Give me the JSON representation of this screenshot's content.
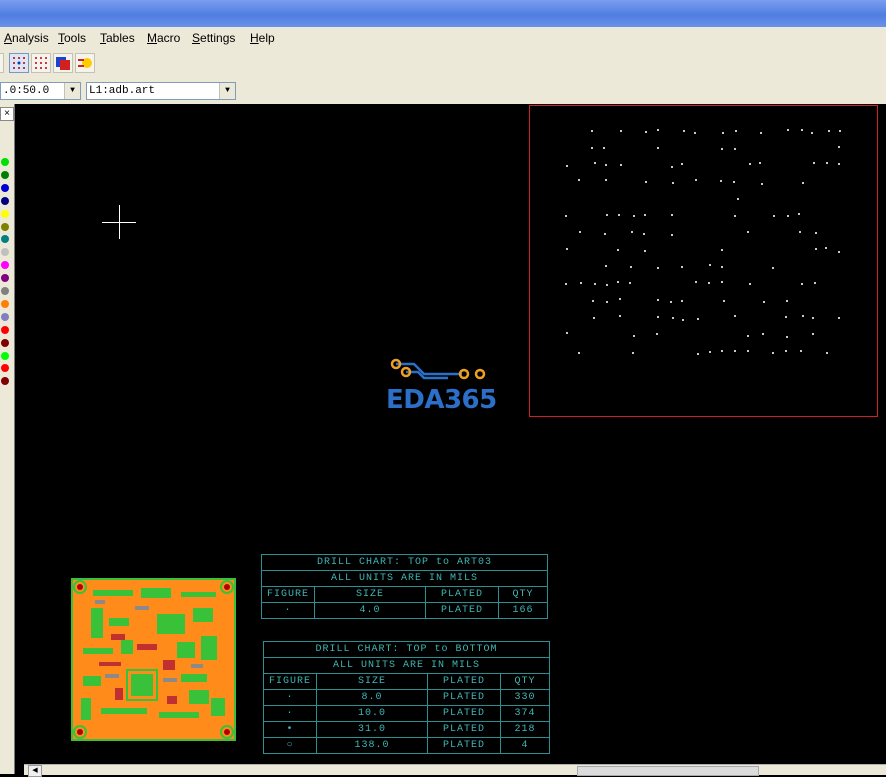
{
  "menu": [
    "Analysis",
    "Tools",
    "Tables",
    "Macro",
    "Settings",
    "Help"
  ],
  "toolbar": {
    "grid_combo_value": ".0:50.0",
    "layer_combo_value": "L1:adb.art"
  },
  "left_panel": {
    "close_glyph": "×",
    "layer_colors": [
      "#00e000",
      "#008000",
      "#0000d0",
      "#000080",
      "#ffff00",
      "#808000",
      "#008080",
      "#c0c0c0",
      "#ff00ff",
      "#800080",
      "#808080",
      "#ff8000",
      "#8080c0",
      "#ff0000",
      "#800000",
      "#00ff00",
      "#ff0000",
      "#800000"
    ]
  },
  "logo": {
    "text": "EDA365"
  },
  "drill_chart_1": {
    "title": "DRILL CHART: TOP to ART03",
    "subtitle": "ALL UNITS ARE IN MILS",
    "headers": [
      "FIGURE",
      "SIZE",
      "PLATED",
      "QTY"
    ],
    "rows": [
      {
        "figure": "·",
        "size": "4.0",
        "plated": "PLATED",
        "qty": "166"
      }
    ]
  },
  "drill_chart_2": {
    "title": "DRILL CHART: TOP to BOTTOM",
    "subtitle": "ALL UNITS ARE IN MILS",
    "headers": [
      "FIGURE",
      "SIZE",
      "PLATED",
      "QTY"
    ],
    "rows": [
      {
        "figure": "·",
        "size": "8.0",
        "plated": "PLATED",
        "qty": "330"
      },
      {
        "figure": "·",
        "size": "10.0",
        "plated": "PLATED",
        "qty": "374"
      },
      {
        "figure": "•",
        "size": "31.0",
        "plated": "PLATED",
        "qty": "218"
      },
      {
        "figure": "○",
        "size": "138.0",
        "plated": "PLATED",
        "qty": "4"
      }
    ]
  },
  "colors": {
    "canvas_bg": "#000000",
    "drill_chart_text": "#3fb5b5",
    "board_outline": "#d02020",
    "pcb_copper": "#ff8c1a",
    "pcb_green": "#39c139"
  }
}
